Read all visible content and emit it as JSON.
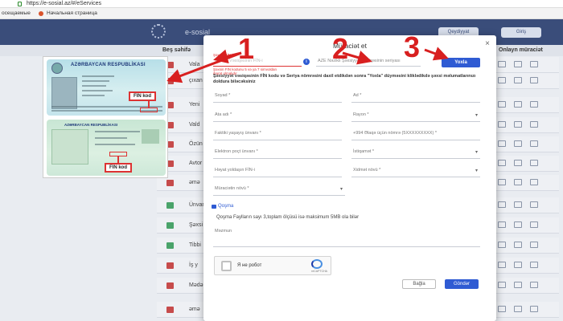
{
  "browser": {
    "url": "https://e-sosial.az/#/eServices",
    "bookmarks": [
      "осещаемые",
      "Начальная страница"
    ]
  },
  "site": {
    "logo": "e-sosial",
    "header_buttons": [
      "Qeydiyyat",
      "Giriş"
    ],
    "subnav_left": "Beş səhifə",
    "subnav_right": "Onlayn müraciət",
    "rows": [
      "Vala",
      "çıxan",
      "Yeni",
      "Vald",
      "Özün",
      "Avtor",
      "əmə",
      "veril",
      "Ünvan",
      "Şəxsi",
      "Tibbi",
      "İş y",
      "Mədə",
      "əmə"
    ]
  },
  "cards": {
    "front_title": "AZƏRBAYCAN RESPUBLİKASI",
    "back_title": "AZƏRBAYCAN RESPUBLİKASI",
    "fin_label_1": "FIN kod",
    "fin_label_2": "FIN kod"
  },
  "modal": {
    "title": "Müraciət et",
    "close": "×",
    "fin_label": "Şəxsin FİN-i",
    "fin_placeholder": "Şəxsin Vəsiqəsinin FİN-i",
    "fin_error": "Şəxsin FİN kodunu 5 və ya 7 simvoldan ibarət olmalıdır",
    "info_icon": "i",
    "series_placeholder": "AZE Nəzikli Şəxsiyyət vəsiqəsinin seriyası",
    "search_button": "Yoxla",
    "notice": "Şəxsiyyət vəsiqəsinin FİN kodu və Seriya nömrəsini daxil etdikdən sonra \"Yoxla\" düyməsini kliklədikdə şəxsi məlumatlarınızı doldura biləcəksiniz",
    "fields": {
      "soyad": "Soyad *",
      "ad": "Ad *",
      "ata_adi": "Ata adı *",
      "rayon": "Rayon *",
      "faktiki": "Faktiki yaşayış ünvanı *",
      "mobil": "+994  Əlaqə üçün nömrə (5XXXXXXXXX) *",
      "email": "Elektron poçt ünvanı *",
      "istiqamet": "İstiqamət *",
      "heyat": "Həyat yoldaşın FİN-i",
      "xidmet": "Xidmət növü *",
      "muraciet_novu": "Müraciətin növü *"
    },
    "attach_link": "Qoşma",
    "attach_note": "Qoşma Faylların sayı 3,toplam ölçüsü isə maksimum 5MB ola bilər",
    "textarea_label": "Məzmun",
    "captcha_text": "Я не робот",
    "captcha_brand": "reCAPTCHA",
    "close_button": "Bağla",
    "send_button": "Göndər"
  },
  "annotations": [
    "1",
    "2",
    "3"
  ],
  "colors": {
    "annotation_red": "#d81f1f",
    "primary_blue": "#2f5bd3",
    "header_navy": "#3a4d7a"
  }
}
